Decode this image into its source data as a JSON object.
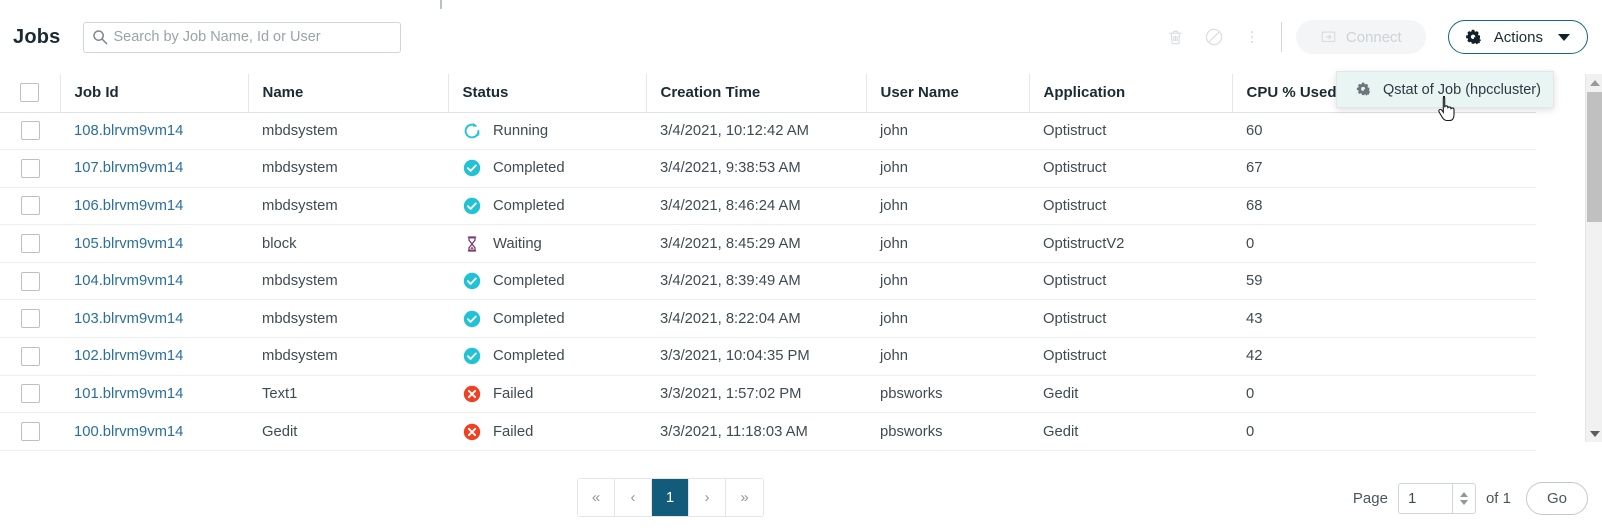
{
  "header": {
    "title": "Jobs",
    "search": {
      "placeholder": "Search by Job Name, Id or User",
      "value": "",
      "icon": "search-icon"
    },
    "icons": [
      {
        "name": "delete-icon",
        "label": "Delete"
      },
      {
        "name": "cancel-icon",
        "label": "Cancel"
      },
      {
        "name": "more-vertical-icon",
        "label": "More"
      }
    ],
    "connect_button": {
      "label": "Connect",
      "icon": "screen-share-icon",
      "disabled": true
    },
    "actions_button": {
      "label": "Actions",
      "icon": "gears-icon",
      "caret": "chevron-down-icon"
    }
  },
  "dropdown": {
    "open": true,
    "items": [
      {
        "label": "Qstat of Job (hpccluster)",
        "icon": "gears-icon",
        "highlighted": true
      }
    ]
  },
  "table": {
    "columns": [
      "Job Id",
      "Name",
      "Status",
      "Creation Time",
      "User Name",
      "Application",
      "CPU % Used"
    ],
    "rows": [
      {
        "job_id": "108.blrvm9vm14",
        "name": "mbdsystem",
        "status": "Running",
        "status_icon": "spinner-icon",
        "creation_time": "3/4/2021, 10:12:42 AM",
        "user": "john",
        "application": "Optistruct",
        "cpu": "60"
      },
      {
        "job_id": "107.blrvm9vm14",
        "name": "mbdsystem",
        "status": "Completed",
        "status_icon": "check-circle-icon",
        "creation_time": "3/4/2021, 9:38:53 AM",
        "user": "john",
        "application": "Optistruct",
        "cpu": "67"
      },
      {
        "job_id": "106.blrvm9vm14",
        "name": "mbdsystem",
        "status": "Completed",
        "status_icon": "check-circle-icon",
        "creation_time": "3/4/2021, 8:46:24 AM",
        "user": "john",
        "application": "Optistruct",
        "cpu": "68"
      },
      {
        "job_id": "105.blrvm9vm14",
        "name": "block",
        "status": "Waiting",
        "status_icon": "hourglass-icon",
        "creation_time": "3/4/2021, 8:45:29 AM",
        "user": "john",
        "application": "OptistructV2",
        "cpu": "0"
      },
      {
        "job_id": "104.blrvm9vm14",
        "name": "mbdsystem",
        "status": "Completed",
        "status_icon": "check-circle-icon",
        "creation_time": "3/4/2021, 8:39:49 AM",
        "user": "john",
        "application": "Optistruct",
        "cpu": "59"
      },
      {
        "job_id": "103.blrvm9vm14",
        "name": "mbdsystem",
        "status": "Completed",
        "status_icon": "check-circle-icon",
        "creation_time": "3/4/2021, 8:22:04 AM",
        "user": "john",
        "application": "Optistruct",
        "cpu": "43"
      },
      {
        "job_id": "102.blrvm9vm14",
        "name": "mbdsystem",
        "status": "Completed",
        "status_icon": "check-circle-icon",
        "creation_time": "3/3/2021, 10:04:35 PM",
        "user": "john",
        "application": "Optistruct",
        "cpu": "42"
      },
      {
        "job_id": "101.blrvm9vm14",
        "name": "Text1",
        "status": "Failed",
        "status_icon": "error-circle-icon",
        "creation_time": "3/3/2021, 1:57:02 PM",
        "user": "pbsworks",
        "application": "Gedit",
        "cpu": "0"
      },
      {
        "job_id": "100.blrvm9vm14",
        "name": "Gedit",
        "status": "Failed",
        "status_icon": "error-circle-icon",
        "creation_time": "3/3/2021, 11:18:03 AM",
        "user": "pbsworks",
        "application": "Gedit",
        "cpu": "0"
      }
    ]
  },
  "pagination": {
    "buttons": [
      "«",
      "‹",
      "1",
      "›",
      "»"
    ],
    "active_index": 2,
    "page_label": "Page",
    "page_value": "1",
    "of_label": "of 1",
    "go_label": "Go"
  },
  "colors": {
    "accent": "#125b7b",
    "link": "#2b6f9a",
    "status_completed": "#21c2d6",
    "status_running": "#21c2d6",
    "status_failed": "#f04124",
    "status_waiting": "#7b3f72",
    "menu_highlight": "#e9f5f3"
  }
}
